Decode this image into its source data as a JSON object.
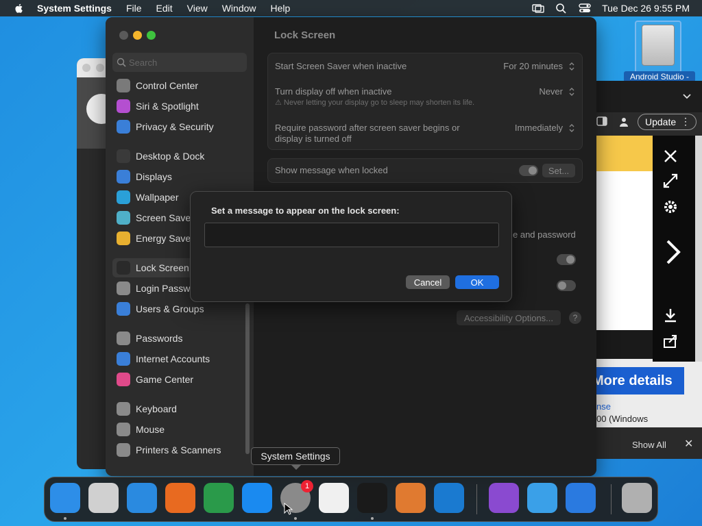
{
  "menubar": {
    "app_name": "System Settings",
    "items": [
      "File",
      "Edit",
      "View",
      "Window",
      "Help"
    ],
    "clock": "Tue Dec 26  9:55 PM"
  },
  "desktop": {
    "drive_label": "Android Studio -"
  },
  "browser_bg": {
    "update_label": "Update",
    "more_details": "More details",
    "link1": "nse",
    "link2": "00 (Windows",
    "show_all": "Show All"
  },
  "sidebar": {
    "search_placeholder": "Search",
    "items": [
      {
        "label": "Control Center",
        "color": "#7a7a7a"
      },
      {
        "label": "Siri & Spotlight",
        "color": "#b44fd0"
      },
      {
        "label": "Privacy & Security",
        "color": "#3a7fd8"
      },
      {
        "label": "Desktop & Dock",
        "color": "#3a3a3a"
      },
      {
        "label": "Displays",
        "color": "#3a7fd8"
      },
      {
        "label": "Wallpaper",
        "color": "#2aa0d8"
      },
      {
        "label": "Screen Saver",
        "color": "#4fb0c8"
      },
      {
        "label": "Energy Saver",
        "color": "#e8b030"
      },
      {
        "label": "Lock Screen",
        "color": "#2a2a2a"
      },
      {
        "label": "Login Password",
        "color": "#8a8a8a"
      },
      {
        "label": "Users & Groups",
        "color": "#3a7fd8"
      },
      {
        "label": "Passwords",
        "color": "#8a8a8a"
      },
      {
        "label": "Internet Accounts",
        "color": "#3a7fd8"
      },
      {
        "label": "Game Center",
        "color": "#e04a8a"
      },
      {
        "label": "Keyboard",
        "color": "#8a8a8a"
      },
      {
        "label": "Mouse",
        "color": "#8a8a8a"
      },
      {
        "label": "Printers & Scanners",
        "color": "#8a8a8a"
      }
    ]
  },
  "content": {
    "title": "Lock Screen",
    "rows": {
      "screensaver_label": "Start Screen Saver when inactive",
      "screensaver_value": "For 20 minutes",
      "display_off_label": "Turn display off when inactive",
      "display_off_value": "Never",
      "display_off_warning": "⚠ Never letting your display go to sleep may shorten its life.",
      "require_pw_label_1": "Require password after screen saver begins or",
      "require_pw_label_2": "display is turned off",
      "require_pw_value": "Immediately",
      "show_message_label": "Show message when locked",
      "set_button": "Set...",
      "partial_text": "e and password",
      "accessibility_button": "Accessibility Options...",
      "help": "?"
    }
  },
  "dialog": {
    "prompt": "Set a message to appear on the lock screen:",
    "input_value": "",
    "cancel": "Cancel",
    "ok": "OK"
  },
  "dock": {
    "tooltip": "System Settings",
    "badge": "1",
    "items": [
      {
        "name": "finder",
        "color": "#2d8ee8"
      },
      {
        "name": "launchpad",
        "color": "#d0d0d0"
      },
      {
        "name": "safari",
        "color": "#2a8ae0"
      },
      {
        "name": "firefox",
        "color": "#e86a20"
      },
      {
        "name": "chrome",
        "color": "#2a9a4a"
      },
      {
        "name": "app-store",
        "color": "#1a8af0"
      },
      {
        "name": "system-settings",
        "color": "#8a8a8a"
      },
      {
        "name": "textedit",
        "color": "#f0f0f0"
      },
      {
        "name": "terminal",
        "color": "#1a1a1a"
      },
      {
        "name": "garageband",
        "color": "#e07a30"
      },
      {
        "name": "vscode",
        "color": "#1a7ad0"
      },
      {
        "name": "visual-studio",
        "color": "#8a4ad0"
      },
      {
        "name": "weather",
        "color": "#3aa0e8"
      },
      {
        "name": "xcode",
        "color": "#2a7ae0"
      },
      {
        "name": "trash",
        "color": "#b0b0b0"
      }
    ]
  }
}
